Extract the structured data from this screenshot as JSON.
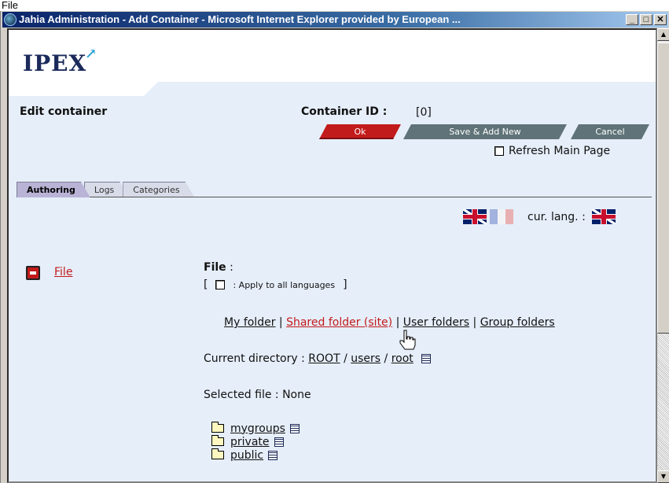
{
  "top_label": "File",
  "window": {
    "title": "Jahia Administration - Add Container - Microsoft Internet Explorer provided by European ...",
    "buttons": {
      "minimize": "_",
      "maximize": "□",
      "close": "✕"
    }
  },
  "brand": {
    "logo": "IPEX"
  },
  "header": {
    "edit_title": "Edit container",
    "container_id_label": "Container ID :",
    "container_id_value": "[0]"
  },
  "actions": {
    "ok": "Ok",
    "save_add_new": "Save & Add New",
    "cancel": "Cancel",
    "refresh_label": "Refresh Main Page",
    "refresh_checked": false
  },
  "tabs": [
    {
      "label": "Authoring",
      "active": true
    },
    {
      "label": "Logs",
      "active": false
    },
    {
      "label": "Categories",
      "active": false
    }
  ],
  "language": {
    "current_label": "cur. lang. :"
  },
  "field": {
    "link_label": "File",
    "title": "File",
    "title_suffix": " :",
    "apply_all_open": "[",
    "apply_all_label": ": Apply to all languages",
    "apply_all_close": "]"
  },
  "folders_nav": {
    "my_folder": "My folder",
    "shared_folder": "Shared folder (site)",
    "user_folders": "User folders",
    "group_folders": "Group folders",
    "separator": "|"
  },
  "current_directory": {
    "label": "Current directory :",
    "root": "ROOT",
    "users": "users",
    "root_user": "root",
    "sep": "/"
  },
  "selected_file": {
    "label": "Selected file : None"
  },
  "folder_list": [
    {
      "name": "mygroups"
    },
    {
      "name": "private"
    },
    {
      "name": "public"
    }
  ],
  "colors": {
    "accent_red": "#c21b1b",
    "panel_bg": "#e6eef9",
    "title_blue": "#0a246a"
  }
}
